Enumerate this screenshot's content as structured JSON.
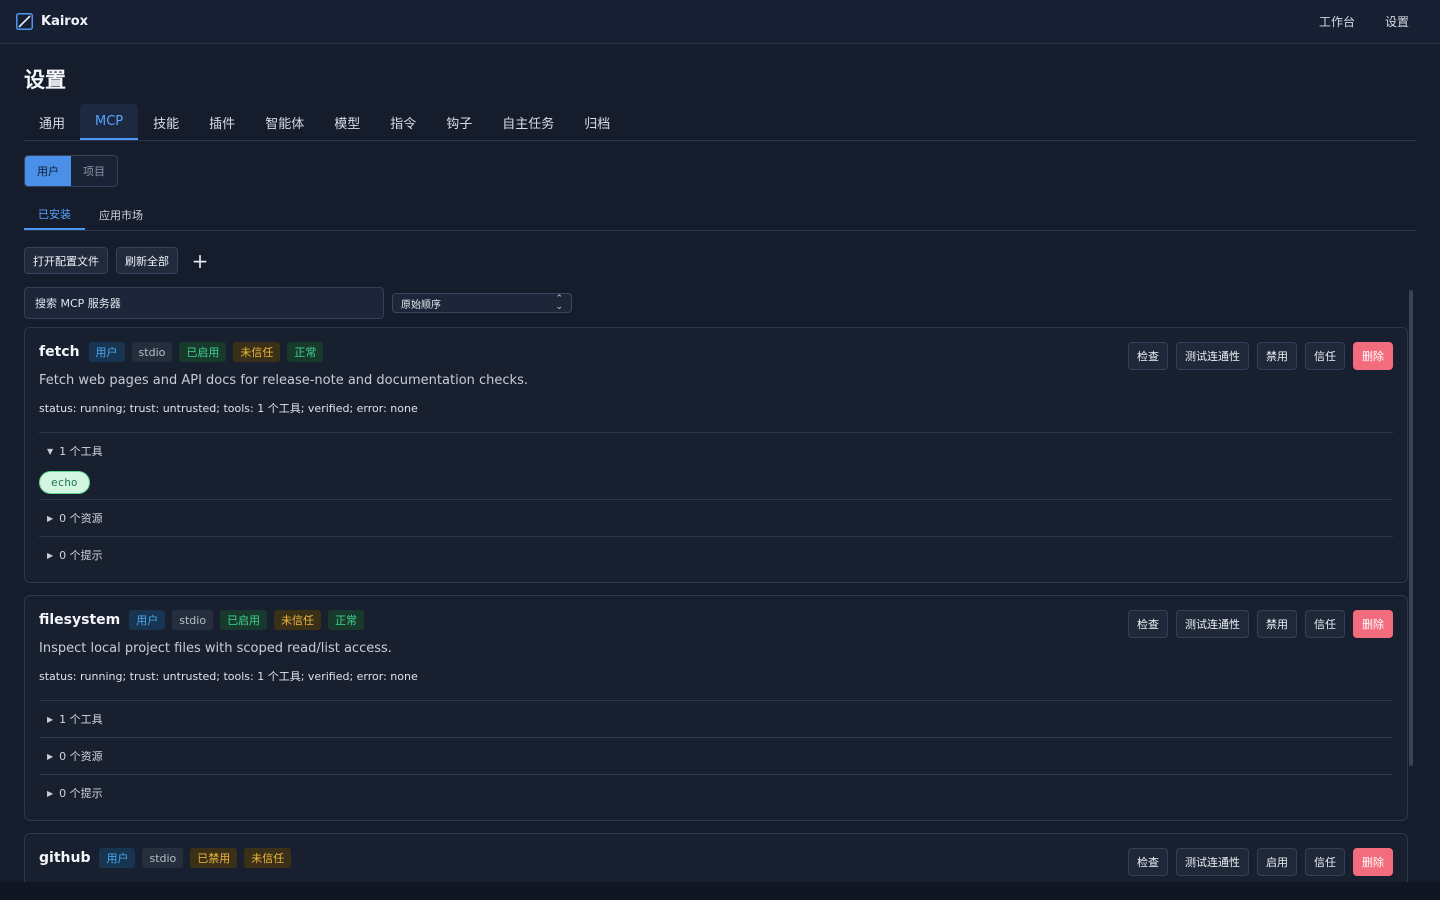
{
  "app": {
    "title": "Kairox",
    "nav": [
      "工作台",
      "设置"
    ]
  },
  "page": {
    "title": "设置",
    "tabs": [
      "通用",
      "MCP",
      "技能",
      "插件",
      "智能体",
      "模型",
      "指令",
      "钩子",
      "自主任务",
      "归档"
    ],
    "active_tab": "MCP"
  },
  "scope": {
    "options": [
      "用户",
      "项目"
    ],
    "active": "用户"
  },
  "subtabs": {
    "items": [
      "已安装",
      "应用市场"
    ],
    "active": "已安装"
  },
  "toolbar": {
    "open_config": "打开配置文件",
    "refresh_all": "刷新全部",
    "add": "+"
  },
  "search": {
    "placeholder": "搜索 MCP 服务器"
  },
  "sort": {
    "value": "原始顺序"
  },
  "servers": [
    {
      "name": "fetch",
      "badges": [
        "用户",
        "stdio",
        "已启用",
        "未信任",
        "正常"
      ],
      "description": "Fetch web pages and API docs for release-note and documentation checks.",
      "status": "status: running; trust: untrusted; tools: 1 个工具; verified; error: none",
      "actions": [
        "检查",
        "测试连通性",
        "禁用",
        "信任",
        "删除"
      ],
      "sections": [
        {
          "label": "1 个工具",
          "expanded": true,
          "marker": "▼",
          "items": [
            "echo"
          ]
        },
        {
          "label": "0 个资源",
          "expanded": false,
          "marker": "▶"
        },
        {
          "label": "0 个提示",
          "expanded": false,
          "marker": "▶"
        }
      ]
    },
    {
      "name": "filesystem",
      "badges": [
        "用户",
        "stdio",
        "已启用",
        "未信任",
        "正常"
      ],
      "description": "Inspect local project files with scoped read/list access.",
      "status": "status: running; trust: untrusted; tools: 1 个工具; verified; error: none",
      "actions": [
        "检查",
        "测试连通性",
        "禁用",
        "信任",
        "删除"
      ],
      "sections": [
        {
          "label": "1 个工具",
          "expanded": false,
          "marker": "▶"
        },
        {
          "label": "0 个资源",
          "expanded": false,
          "marker": "▶"
        },
        {
          "label": "0 个提示",
          "expanded": false,
          "marker": "▶"
        }
      ]
    },
    {
      "name": "github",
      "badges": [
        "用户",
        "stdio",
        "已禁用",
        "未信任"
      ],
      "actions": [
        "检查",
        "测试连通性",
        "启用",
        "信任",
        "删除"
      ]
    }
  ]
}
